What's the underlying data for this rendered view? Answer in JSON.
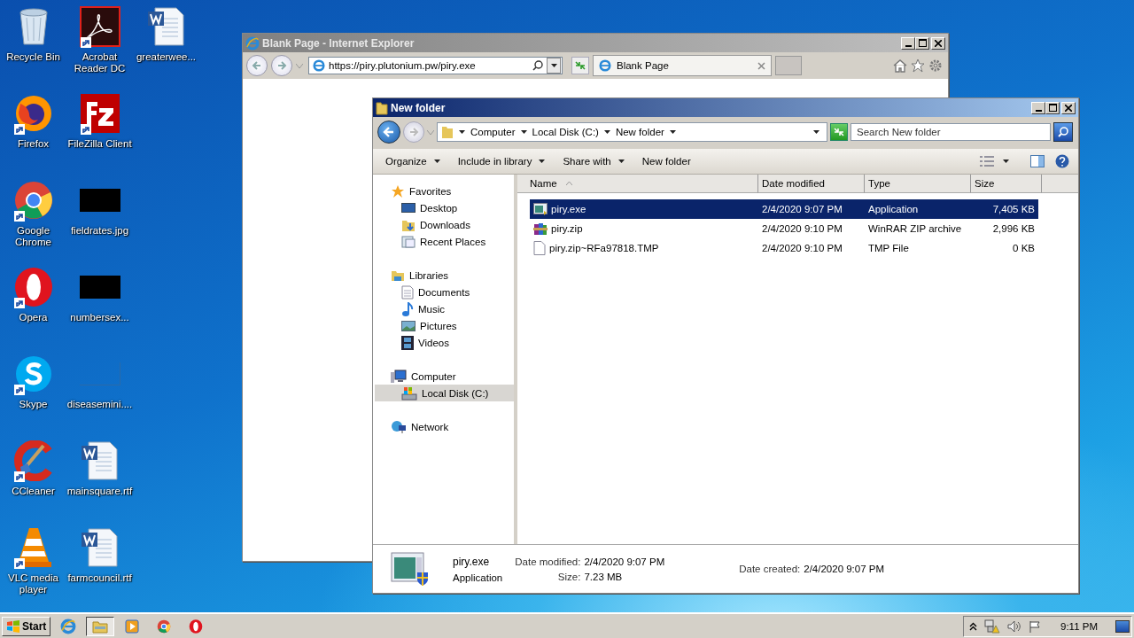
{
  "desktop": {
    "icons": [
      {
        "label": "Recycle Bin",
        "kind": "recycle",
        "shortcut": false
      },
      {
        "label": "Firefox",
        "kind": "firefox",
        "shortcut": true
      },
      {
        "label": "Google Chrome",
        "kind": "chrome",
        "shortcut": true
      },
      {
        "label": "Opera",
        "kind": "opera",
        "shortcut": true
      },
      {
        "label": "Skype",
        "kind": "skype",
        "shortcut": true
      },
      {
        "label": "CCleaner",
        "kind": "ccleaner",
        "shortcut": true
      },
      {
        "label": "VLC media player",
        "kind": "vlc",
        "shortcut": true
      },
      {
        "label": "Acrobat Reader DC",
        "kind": "acrobat",
        "shortcut": true
      },
      {
        "label": "FileZilla Client",
        "kind": "filezilla",
        "shortcut": true
      },
      {
        "label": "fieldrates.jpg",
        "kind": "image",
        "shortcut": false
      },
      {
        "label": "numbersex...",
        "kind": "image",
        "shortcut": false
      },
      {
        "label": "diseasemini....",
        "kind": "blank",
        "shortcut": false
      },
      {
        "label": "mainsquare.rtf",
        "kind": "word",
        "shortcut": false
      },
      {
        "label": "farmcouncil.rtf",
        "kind": "word",
        "shortcut": false
      },
      {
        "label": "greaterwee...",
        "kind": "word",
        "shortcut": false
      }
    ]
  },
  "browser": {
    "title": "Blank Page - Internet Explorer",
    "address": "https://piry.plutonium.pw/piry.exe",
    "tabs": [
      {
        "label": "Blank Page",
        "selected": true
      }
    ]
  },
  "explorer": {
    "title": "New folder",
    "breadcrumb": [
      "Computer",
      "Local Disk (C:)",
      "New folder"
    ],
    "search": {
      "placeholder": "Search New folder"
    },
    "commands": [
      {
        "label": "Organize",
        "dropdown": true
      },
      {
        "label": "Include in library",
        "dropdown": true
      },
      {
        "label": "Share with",
        "dropdown": true
      },
      {
        "label": "New folder",
        "dropdown": false
      }
    ],
    "nav": [
      {
        "label": "Favorites",
        "kind": "star",
        "selected": false,
        "children": [
          {
            "label": "Desktop",
            "kind": "desktop",
            "selected": false
          },
          {
            "label": "Downloads",
            "kind": "downloads",
            "selected": false
          },
          {
            "label": "Recent Places",
            "kind": "recent",
            "selected": false
          }
        ]
      },
      {
        "label": "Libraries",
        "kind": "libraries",
        "selected": false,
        "children": [
          {
            "label": "Documents",
            "kind": "documents",
            "selected": false
          },
          {
            "label": "Music",
            "kind": "music",
            "selected": false
          },
          {
            "label": "Pictures",
            "kind": "pictures",
            "selected": false
          },
          {
            "label": "Videos",
            "kind": "videos",
            "selected": false
          }
        ]
      },
      {
        "label": "Computer",
        "kind": "computer",
        "selected": false,
        "children": [
          {
            "label": "Local Disk (C:)",
            "kind": "disk",
            "selected": true
          }
        ]
      },
      {
        "label": "Network",
        "kind": "network",
        "selected": false
      }
    ],
    "columns": [
      "Name",
      "Date modified",
      "Type",
      "Size"
    ],
    "files": [
      {
        "name": "piry.exe",
        "date": "2/4/2020 9:07 PM",
        "type": "Application",
        "size": "7,405 KB",
        "kind": "exe",
        "selected": true
      },
      {
        "name": "piry.zip",
        "date": "2/4/2020 9:10 PM",
        "type": "WinRAR ZIP archive",
        "size": "2,996 KB",
        "kind": "zip",
        "selected": false
      },
      {
        "name": "piry.zip~RFa97818.TMP",
        "date": "2/4/2020 9:10 PM",
        "type": "TMP File",
        "size": "0 KB",
        "kind": "file",
        "selected": false
      }
    ],
    "details": {
      "name": "piry.exe",
      "type": "Application",
      "modified_label": "Date modified:",
      "modified": "2/4/2020 9:07 PM",
      "size_label": "Size:",
      "size": "7.23 MB",
      "created_label": "Date created:",
      "created": "2/4/2020 9:07 PM"
    }
  },
  "taskbar": {
    "start": "Start",
    "apps": [
      {
        "kind": "ie",
        "selected": false
      },
      {
        "kind": "explorer",
        "selected": true
      },
      {
        "kind": "media",
        "selected": false
      },
      {
        "kind": "chrome",
        "selected": false
      },
      {
        "kind": "opera",
        "selected": false
      }
    ],
    "clock": "9:11 PM"
  }
}
